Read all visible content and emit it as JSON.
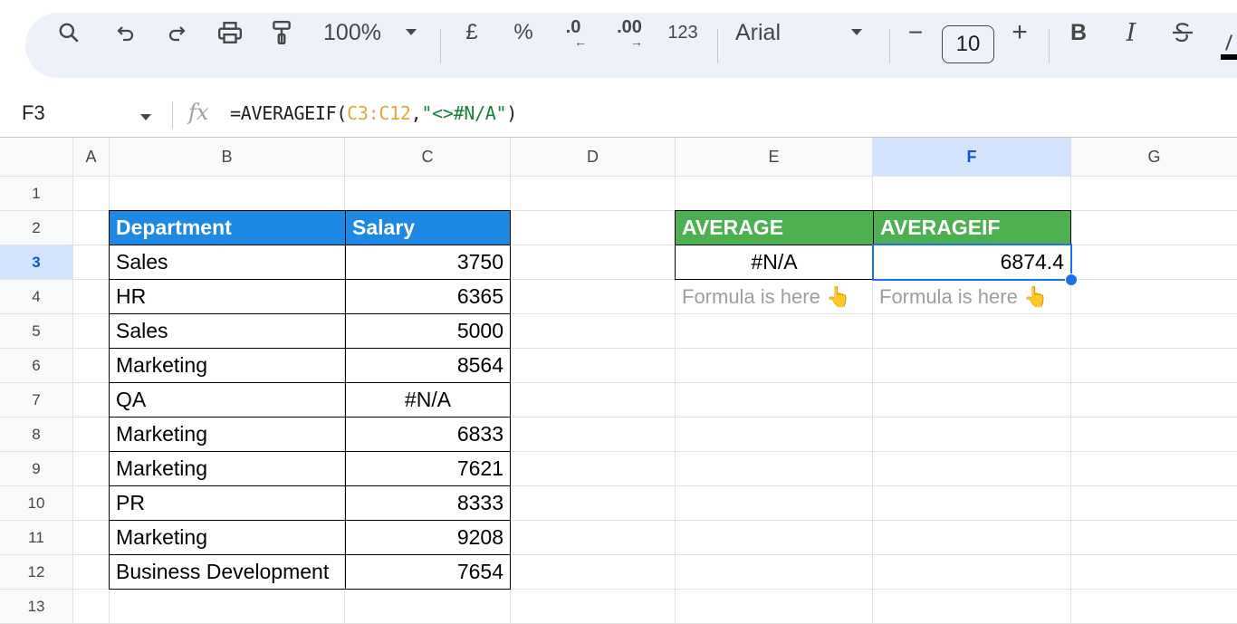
{
  "toolbar": {
    "zoom": "100%",
    "currency": "£",
    "percent": "%",
    "decrease_decimal": ".0",
    "increase_decimal": ".00",
    "number_format": "123",
    "font": "Arial",
    "font_size": "10",
    "minus": "−",
    "plus": "+",
    "bold": "B",
    "italic": "I"
  },
  "formula_bar": {
    "name_box": "F3",
    "fx": "fx",
    "formula_fn": "=AVERAGEIF(",
    "formula_ref": "C3:C12",
    "formula_comma": ",",
    "formula_str": "\"<>#N/A\"",
    "formula_close": ")"
  },
  "columns": [
    "A",
    "B",
    "C",
    "D",
    "E",
    "F",
    "G"
  ],
  "rows": [
    "1",
    "2",
    "3",
    "4",
    "5",
    "6",
    "7",
    "8",
    "9",
    "10",
    "11",
    "12",
    "13"
  ],
  "table": {
    "headers": [
      "Department",
      "Salary"
    ],
    "rows": [
      [
        "Sales",
        "3750"
      ],
      [
        "HR",
        "6365"
      ],
      [
        "Sales",
        "5000"
      ],
      [
        "Marketing",
        "8564"
      ],
      [
        "QA",
        "#N/A"
      ],
      [
        "Marketing",
        "6833"
      ],
      [
        "Marketing",
        "7621"
      ],
      [
        "PR",
        "8333"
      ],
      [
        "Marketing",
        "9208"
      ],
      [
        "Business Development",
        "7654"
      ]
    ]
  },
  "results": {
    "average_header": "AVERAGE",
    "averageif_header": "AVERAGEIF",
    "average_value": "#N/A",
    "averageif_value": "6874.4",
    "note_e": "Formula is here 👆",
    "note_f": "Formula is here 👆"
  },
  "colors": {
    "blue_header": "#1e88e5",
    "green_header": "#4caf50",
    "selection": "#1a73e8"
  }
}
